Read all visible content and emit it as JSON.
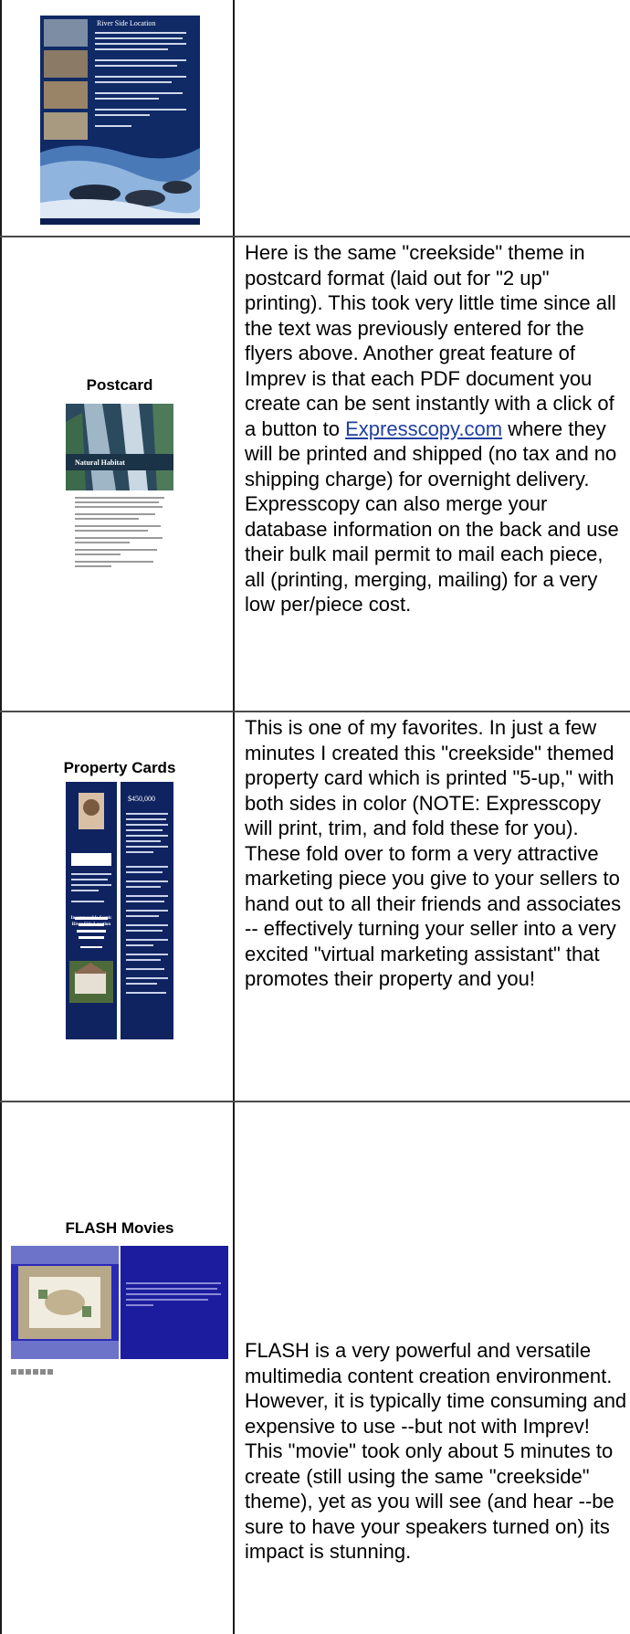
{
  "rows": [
    {
      "label": "",
      "image_desc": "flyer-river-side-location",
      "thumb_heading": "River Side Location",
      "text": []
    },
    {
      "label": "Postcard",
      "image_desc": "postcard-natural-habitat",
      "thumb_heading": "Natural Habitat",
      "text": [
        "Here is the same \"creekside\" theme in postcard format (laid out for \"2 up\" printing).  This took very little time since all the text was previously entered for the flyers above.  Another great feature of Imprev is that each PDF document you create can be sent instantly with a click of a button to ",
        "Expresscopy.com",
        " where they will be printed and shipped (no tax and no shipping charge) for overnight delivery. Expresscopy can also merge your database information on the back and use their bulk mail permit to mail each piece, all (printing, merging, mailing) for a very low per/piece cost."
      ]
    },
    {
      "label": "Property Cards",
      "image_desc": "property-card",
      "thumb_price": "$450,000",
      "thumb_heading": "Incomparable Scenic River Side Location",
      "text": [
        "This is one of my favorites.  In just a few minutes I created this \"creekside\" themed property card which is printed \"5-up,\" with both sides in color (NOTE: Expresscopy will print, trim, and fold these for you).  These fold over to form a very attractive marketing piece you give to your sellers to hand out to all their friends and associates -- effectively turning your seller into a very excited \"virtual marketing assistant\" that promotes their property and you!"
      ]
    },
    {
      "label": "FLASH Movies",
      "image_desc": "flash-movie-still",
      "text": [
        "FLASH is a very powerful and versatile multimedia content creation environment.  However, it is typically time consuming and expensive to use --but not with Imprev!  This \"movie\" took only about 5 minutes to create (still using the same \"creekside\" theme), yet as you will see (and hear --be sure to have your speakers turned on) its impact is stunning."
      ]
    }
  ],
  "colors": {
    "navy": "#0f2361",
    "flash_blue": "#1c1c9e",
    "link": "#1f3f9f"
  }
}
